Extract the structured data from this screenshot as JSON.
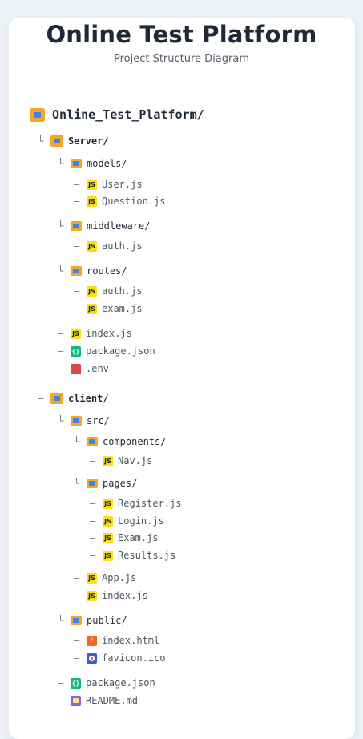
{
  "header": {
    "title": "Online Test Platform",
    "subtitle": "Project Structure Diagram"
  },
  "connectors": {
    "branch": "└",
    "dash": "—"
  },
  "icons": {
    "folder": "folder-icon",
    "js": "javascript-file-icon",
    "json": "json-file-icon",
    "env": "env-file-icon",
    "html": "html-file-icon",
    "ico": "favicon-file-icon",
    "md": "markdown-file-icon"
  },
  "icon_labels": {
    "js": "JS",
    "json": "{}",
    "html": "⚡"
  },
  "colors": {
    "folder": "#f5a623",
    "folder_inner": "#3b82f6",
    "js": "#f7df1e",
    "json": "#10b981",
    "env": "#d94848",
    "html": "#f06529",
    "favicon": "#3b5bdb",
    "markdown": "#8b5cf6"
  },
  "tree": {
    "root": "Online_Test_Platform/",
    "server": {
      "label": "Server/",
      "models": {
        "label": "models/",
        "files": [
          "User.js",
          "Question.js"
        ]
      },
      "middleware": {
        "label": "middleware/",
        "files": [
          "auth.js"
        ]
      },
      "routes": {
        "label": "routes/",
        "files": [
          "auth.js",
          "exam.js"
        ]
      },
      "files": [
        "index.js",
        "package.json",
        ".env"
      ]
    },
    "client": {
      "label": "client/",
      "src": {
        "label": "src/",
        "components": {
          "label": "components/",
          "files": [
            "Nav.js"
          ]
        },
        "pages": {
          "label": "pages/",
          "files": [
            "Register.js",
            "Login.js",
            "Exam.js",
            "Results.js"
          ]
        },
        "files": [
          "App.js",
          "index.js"
        ]
      },
      "public": {
        "label": "public/",
        "files": [
          "index.html",
          "favicon.ico"
        ]
      },
      "files": [
        "package.json",
        "README.md"
      ]
    }
  }
}
